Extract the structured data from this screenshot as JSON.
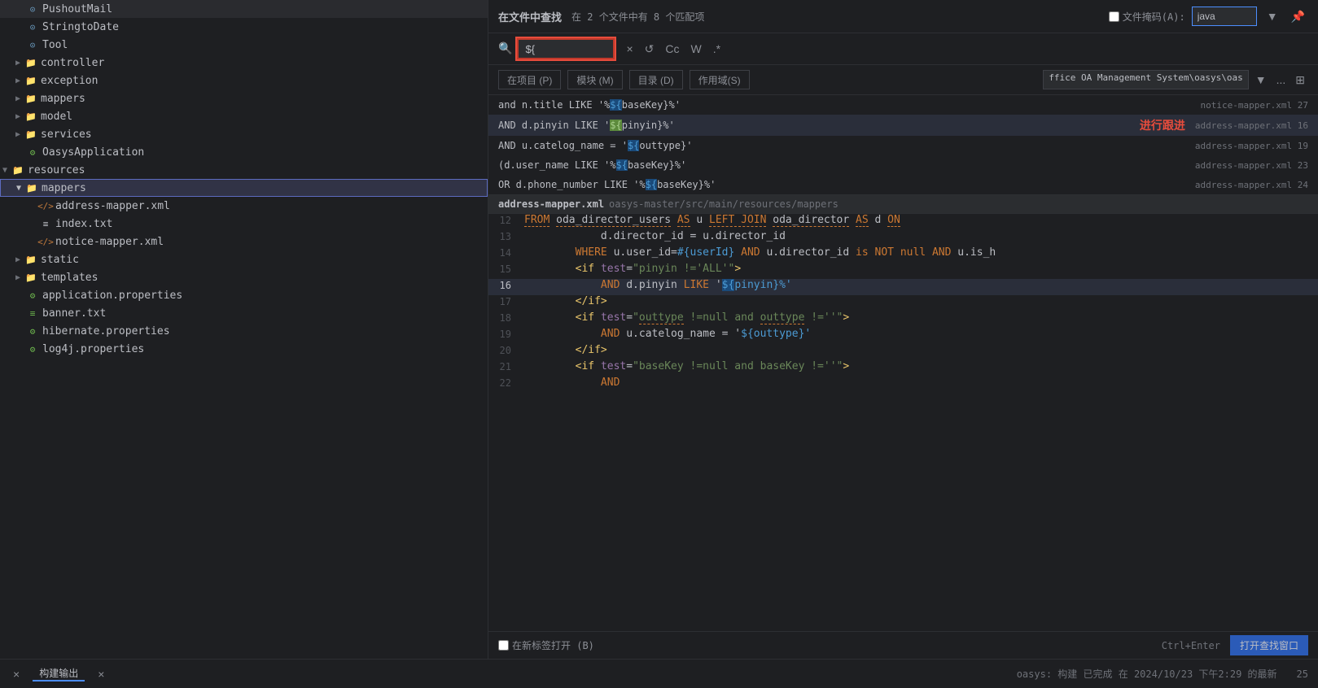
{
  "left": {
    "tree": [
      {
        "id": "pushoutmail",
        "label": "PushoutMail",
        "type": "circle",
        "indent": 2
      },
      {
        "id": "stringtodate",
        "label": "StringtoDate",
        "type": "circle",
        "indent": 2
      },
      {
        "id": "tool",
        "label": "Tool",
        "type": "circle",
        "indent": 2
      },
      {
        "id": "controller",
        "label": "controller",
        "type": "folder",
        "indent": 1,
        "collapsed": true
      },
      {
        "id": "exception",
        "label": "exception",
        "type": "folder",
        "indent": 1,
        "collapsed": true
      },
      {
        "id": "mappers",
        "label": "mappers",
        "type": "folder",
        "indent": 1,
        "collapsed": true
      },
      {
        "id": "model",
        "label": "model",
        "type": "folder",
        "indent": 1,
        "collapsed": true
      },
      {
        "id": "services",
        "label": "services",
        "type": "folder",
        "indent": 1,
        "collapsed": true
      },
      {
        "id": "oasysapplication",
        "label": "OasysApplication",
        "type": "app",
        "indent": 2
      },
      {
        "id": "resources",
        "label": "resources",
        "type": "folder",
        "indent": 0,
        "collapsed": false
      },
      {
        "id": "mappers-res",
        "label": "mappers",
        "type": "folder",
        "indent": 1,
        "collapsed": false,
        "selected": true
      },
      {
        "id": "address-mapper",
        "label": "address-mapper.xml",
        "type": "xml",
        "indent": 3
      },
      {
        "id": "index-txt",
        "label": "index.txt",
        "type": "txt",
        "indent": 3
      },
      {
        "id": "notice-mapper",
        "label": "notice-mapper.xml",
        "type": "xml",
        "indent": 3
      },
      {
        "id": "static",
        "label": "static",
        "type": "folder",
        "indent": 1,
        "collapsed": true
      },
      {
        "id": "templates",
        "label": "templates",
        "type": "folder",
        "indent": 1,
        "collapsed": true
      },
      {
        "id": "application-props",
        "label": "application.properties",
        "type": "props",
        "indent": 2
      },
      {
        "id": "banner-txt",
        "label": "banner.txt",
        "type": "txt-gear",
        "indent": 2
      },
      {
        "id": "hibernate-props",
        "label": "hibernate.properties",
        "type": "props",
        "indent": 2
      },
      {
        "id": "log4j-props",
        "label": "log4j.properties",
        "type": "props",
        "indent": 2
      }
    ]
  },
  "search": {
    "title": "在文件中查找",
    "count_text": "在 2 个文件中有 8 个匹配项",
    "file_mask_label": "文件掩码(A):",
    "file_mask_value": "java",
    "search_value": "${"
  },
  "scope_buttons": [
    {
      "id": "project",
      "label": "在项目 (P)"
    },
    {
      "id": "module",
      "label": "模块 (M)"
    },
    {
      "id": "directory",
      "label": "目录 (D)"
    },
    {
      "id": "scope",
      "label": "作用域(S)"
    }
  ],
  "scope_path": "ffice OA Management System\\oasys\\oas",
  "results": [
    {
      "text": "and n.title LIKE '%${baseKey}%'",
      "highlight_word": "${baseKey}",
      "file": "notice-mapper.xml",
      "line": "27",
      "active": false
    },
    {
      "text": "AND d.pinyin LIKE '${pinyin}%'",
      "highlight_word": "${pinyin}",
      "file": "address-mapper.xml",
      "line": "16",
      "active": true,
      "annotation": "进行跟进"
    },
    {
      "text": "AND u.catelog_name = '${outtype}'",
      "highlight_word": "${outtype}",
      "file": "address-mapper.xml",
      "line": "19",
      "active": false
    },
    {
      "text": "(d.user_name LIKE '%${baseKey}%'",
      "highlight_word": "${baseKey}",
      "file": "address-mapper.xml",
      "line": "23",
      "active": false
    },
    {
      "text": "OR d.phone_number LIKE '%${baseKey}%'",
      "highlight_word": "${baseKey}",
      "file": "address-mapper.xml",
      "line": "24",
      "active": false
    }
  ],
  "code": {
    "file_name": "address-mapper.xml",
    "file_path": "oasys-master/src/main/resources/mappers",
    "lines": [
      {
        "num": "12",
        "content": "        FROM oda_director_users AS u LEFT JOIN oda_director AS d ON"
      },
      {
        "num": "13",
        "content": "            d.director_id = u.director_id"
      },
      {
        "num": "14",
        "content": "        WHERE u.user_id=#{userId} AND u.director_id is NOT null AND u.is_h"
      },
      {
        "num": "15",
        "content": "        <if test=\"pinyin !='ALL'\">"
      },
      {
        "num": "16",
        "content": "            AND d.pinyin LIKE '${pinyin}%'",
        "highlight_var": "${",
        "highlight_start": 32
      },
      {
        "num": "17",
        "content": "        </if>"
      },
      {
        "num": "18",
        "content": "        <if test=\"outtype !=null and outtype !=''\">"
      },
      {
        "num": "19",
        "content": "            AND u.catelog_name = '${outtype}'"
      },
      {
        "num": "20",
        "content": "        </if>"
      },
      {
        "num": "21",
        "content": "        <if test=\"baseKey !=null and baseKey !=''\">"
      },
      {
        "num": "22",
        "content": "            AND"
      }
    ]
  },
  "bottom": {
    "close_icon": "×",
    "tab_label": "构建输出",
    "status_text": "oasys: 构建 已完成 在 2024/10/23 下午2:29 的最新",
    "open_new_tab_label": "在新标签打开 (B)",
    "open_window_label": "打开查找窗口",
    "shortcut": "Ctrl+Enter",
    "page_num": "25"
  }
}
